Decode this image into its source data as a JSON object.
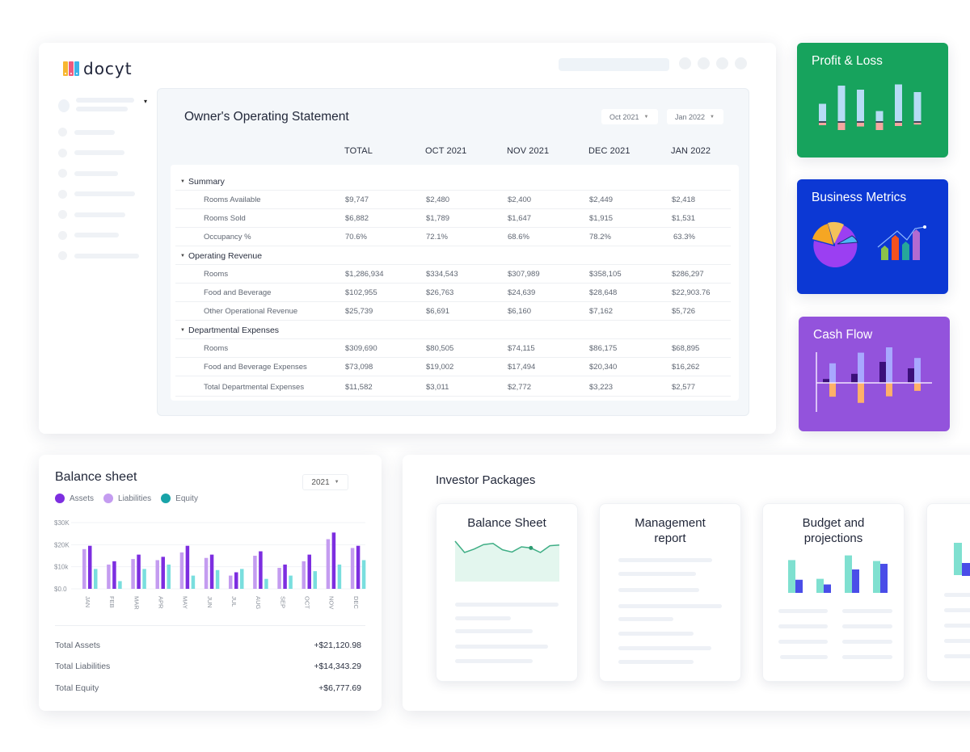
{
  "app": {
    "logo_text": "docyt",
    "logo_colors": [
      "#f7b731",
      "#ef5a7e",
      "#3db3e8"
    ]
  },
  "statement": {
    "title": "Owner's Operating Statement",
    "date_from": "Oct 2021",
    "date_to": "Jan 2022",
    "columns": [
      "TOTAL",
      "OCT 2021",
      "NOV 2021",
      "DEC 2021",
      "JAN 2022"
    ],
    "sections": [
      {
        "name": "Summary",
        "rows": [
          {
            "label": "Rooms Available",
            "values": [
              "$9,747",
              "$2,480",
              "$2,400",
              "$2,449",
              "$2,418"
            ]
          },
          {
            "label": "Rooms Sold",
            "values": [
              "$6,882",
              "$1,789",
              "$1,647",
              "$1,915",
              "$1,531"
            ]
          },
          {
            "label": "Occupancy %",
            "values": [
              "70.6%",
              "72.1%",
              "68.6%",
              "78.2%",
              "63.3%"
            ]
          }
        ]
      },
      {
        "name": "Operating Revenue",
        "rows": [
          {
            "label": "Rooms",
            "values": [
              "$1,286,934",
              "$334,543",
              "$307,989",
              "$358,105",
              "$286,297"
            ]
          },
          {
            "label": "Food and Beverage",
            "values": [
              "$102,955",
              "$26,763",
              "$24,639",
              "$28,648",
              "$22,903.76"
            ]
          },
          {
            "label": "Other Operational Revenue",
            "values": [
              "$25,739",
              "$6,691",
              "$6,160",
              "$7,162",
              "$5,726"
            ]
          }
        ]
      },
      {
        "name": "Departmental Expenses",
        "rows": [
          {
            "label": "Rooms",
            "values": [
              "$309,690",
              "$80,505",
              "$74,115",
              "$86,175",
              "$68,895"
            ]
          },
          {
            "label": "Food and Beverage Expenses",
            "values": [
              "$73,098",
              "$19,002",
              "$17,494",
              "$20,340",
              "$16,262"
            ]
          },
          {
            "label": "Total Departmental Expenses",
            "values": [
              "$11,582",
              "$3,011",
              "$2,772",
              "$3,223",
              "$2,577"
            ]
          }
        ]
      }
    ]
  },
  "tiles": {
    "profit_loss": {
      "title": "Profit & Loss",
      "color": "#17a35d",
      "profit": [
        0.45,
        0.9,
        0.8,
        0.27,
        0.93,
        0.74
      ],
      "loss": [
        0.1,
        0.4,
        0.18,
        0.4,
        0.15,
        0.06
      ]
    },
    "business_metrics": {
      "title": "Business Metrics",
      "color": "#0c38d4"
    },
    "cash_flow": {
      "title": "Cash Flow",
      "color": "#9353dc",
      "dark": [
        0.12,
        0.28,
        0.65,
        0.45
      ],
      "light": [
        0.55,
        0.85,
        1.0,
        0.7
      ],
      "neg": [
        0.38,
        0.55,
        0.37,
        0.22
      ]
    }
  },
  "balance_sheet": {
    "title": "Balance sheet",
    "year": "2021",
    "totals": [
      {
        "label": "Total Assets",
        "value": "+$21,120.98"
      },
      {
        "label": "Total Liabilities",
        "value": "+$14,343.29"
      },
      {
        "label": "Total Equity",
        "value": "+$6,777.69"
      }
    ]
  },
  "chart_data": {
    "type": "bar",
    "title": "Balance sheet",
    "categories": [
      "JAN",
      "FEB",
      "MAR",
      "APR",
      "MAY",
      "JUN",
      "JUL",
      "AUG",
      "SEP",
      "OCT",
      "NOV",
      "DEC"
    ],
    "series": [
      {
        "name": "Liabilities",
        "color": "#c49cf0",
        "values": [
          18000,
          11000,
          13500,
          13000,
          16500,
          14000,
          6000,
          15000,
          9500,
          12500,
          22500,
          18500
        ]
      },
      {
        "name": "Assets",
        "color": "#7d2ee0",
        "values": [
          19500,
          12500,
          15500,
          14500,
          19500,
          15500,
          7500,
          17000,
          11000,
          15500,
          25500,
          19500
        ]
      },
      {
        "name": "Equity",
        "color": "#79dede",
        "values": [
          9000,
          3500,
          9000,
          11000,
          6000,
          8500,
          9000,
          4500,
          6000,
          8000,
          11000,
          13000
        ]
      }
    ],
    "legend": [
      "Assets",
      "Liabilities",
      "Equity"
    ],
    "legend_colors": [
      "#7d2ee0",
      "#c49cf0",
      "#18a3a8"
    ],
    "y_ticks": [
      "$0.0",
      "$10k",
      "$20K",
      "$30K"
    ],
    "ylim": [
      0,
      30000
    ],
    "xlabel": "",
    "ylabel": "",
    "grid": true,
    "legend_position": "top-left"
  },
  "investor_packages": {
    "title": "Investor Packages",
    "packages": [
      {
        "title": "Balance Sheet",
        "line_values": [
          1.0,
          0.5,
          0.65,
          0.85,
          0.9,
          0.62,
          0.52,
          0.75,
          0.7,
          0.5,
          0.8,
          0.83
        ]
      },
      {
        "title": "Management report"
      },
      {
        "title": "Budget and projections",
        "actual": [
          0.7,
          0.3,
          0.8,
          0.68
        ],
        "projected": [
          0.28,
          0.18,
          0.5,
          0.62
        ]
      },
      {
        "title": ""
      }
    ]
  }
}
